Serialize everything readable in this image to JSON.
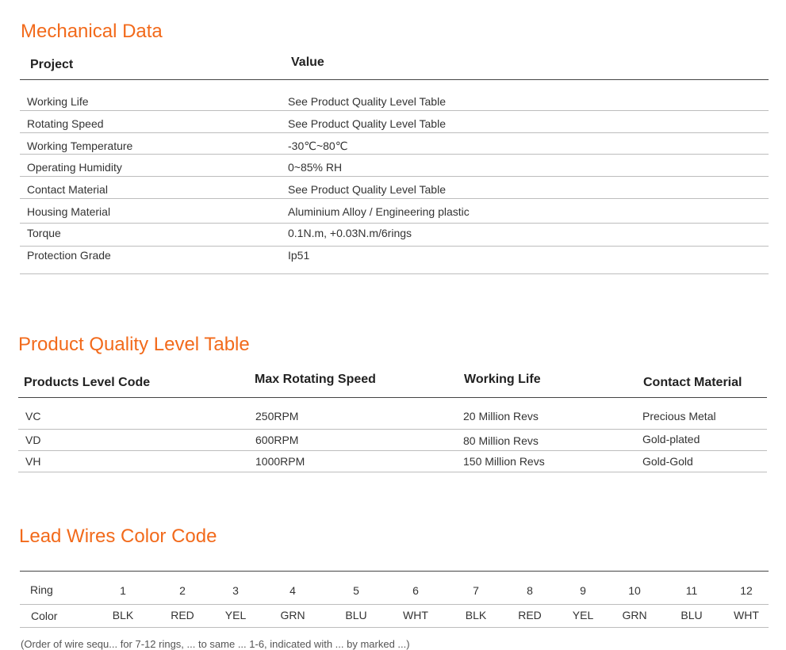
{
  "mechanical": {
    "title": "Mechanical Data",
    "headers": {
      "project": "Project",
      "value": "Value"
    },
    "rows": [
      {
        "project": "Working Life",
        "value": "See Product Quality Level Table"
      },
      {
        "project": "Rotating Speed",
        "value": "See Product Quality Level Table"
      },
      {
        "project": "Working Temperature",
        "value": "-30℃~80℃"
      },
      {
        "project": "Operating Humidity",
        "value": "0~85% RH"
      },
      {
        "project": "Contact Material",
        "value": "See Product Quality Level Table"
      },
      {
        "project": "Housing Material",
        "value": "Aluminium Alloy / Engineering plastic"
      },
      {
        "project": "Torque",
        "value": "0.1N.m,   +0.03N.m/6rings"
      },
      {
        "project": "Protection Grade",
        "value": "Ip51"
      }
    ]
  },
  "quality": {
    "title": "Product Quality Level Table",
    "headers": [
      "Products Level Code",
      "Max Rotating Speed",
      "Working Life",
      "Contact Material"
    ],
    "rows": [
      [
        "VC",
        "250RPM",
        "20 Million Revs",
        "Precious Metal"
      ],
      [
        "VD",
        "600RPM",
        "80 Million Revs",
        "Gold-plated"
      ],
      [
        "VH",
        "1000RPM",
        "150 Million Revs",
        "Gold-Gold"
      ]
    ]
  },
  "leadwires": {
    "title": "Lead Wires Color Code",
    "ring_label": "Ring",
    "color_label": "Color",
    "rings": [
      "1",
      "2",
      "3",
      "4",
      "5",
      "6",
      "7",
      "8",
      "9",
      "10",
      "11",
      "12"
    ],
    "colors": [
      "BLK",
      "RED",
      "YEL",
      "GRN",
      "BLU",
      "WHT",
      "BLK",
      "RED",
      "YEL",
      "GRN",
      "BLU",
      "WHT"
    ]
  },
  "footnote": "(Order of wire sequ... for 7-12 rings, ... to same ... 1-6, indicated with ... by marked ...)"
}
